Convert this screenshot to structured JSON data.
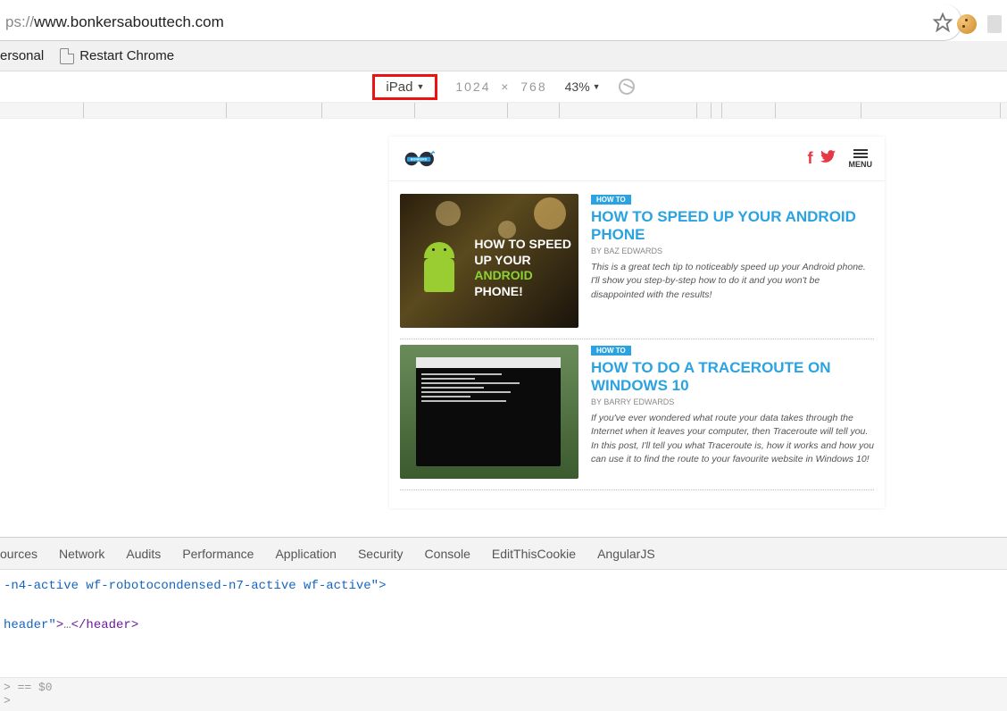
{
  "address": {
    "protocol": "ps://",
    "host": "www.bonkersabouttech.com"
  },
  "bookmarks": {
    "personal": "ersonal",
    "restart": "Restart Chrome"
  },
  "device_toolbar": {
    "device": "iPad",
    "w": "1024",
    "x": "×",
    "h": "768",
    "zoom": "43%"
  },
  "site": {
    "menu_label": "MENU",
    "articles": [
      {
        "badge": "HOW TO",
        "title": "HOW TO SPEED UP YOUR ANDROID PHONE",
        "author": "BY BAZ EDWARDS",
        "excerpt": "This is a great tech tip to noticeably speed up your Android phone. I'll show you step-by-step how to do it and you won't be disappointed with the results!",
        "thumb_text1": "HOW TO SPEED",
        "thumb_text2": "UP YOUR ",
        "thumb_text3": "ANDROID",
        "thumb_text4": "PHONE!"
      },
      {
        "badge": "HOW TO",
        "title": "HOW TO DO A TRACEROUTE ON WINDOWS 10",
        "author": "BY BARRY EDWARDS",
        "excerpt": "If you've ever wondered what route your data takes through the Internet when it leaves your computer, then Traceroute will tell you. In this post, I'll tell you what Traceroute is, how it works and how you can use it to find the route to your favourite website in Windows 10!"
      }
    ]
  },
  "devtools": {
    "tabs": [
      "ources",
      "Network",
      "Audits",
      "Performance",
      "Application",
      "Security",
      "Console",
      "EditThisCookie",
      "AngularJS"
    ],
    "line1": "-n4-active wf-robotocondensed-n7-active wf-active\">",
    "line2_open": "header\">",
    "line2_ellipsis": "…",
    "line2_close": "</header>",
    "footer1": "> == $0",
    "footer2": ">"
  }
}
